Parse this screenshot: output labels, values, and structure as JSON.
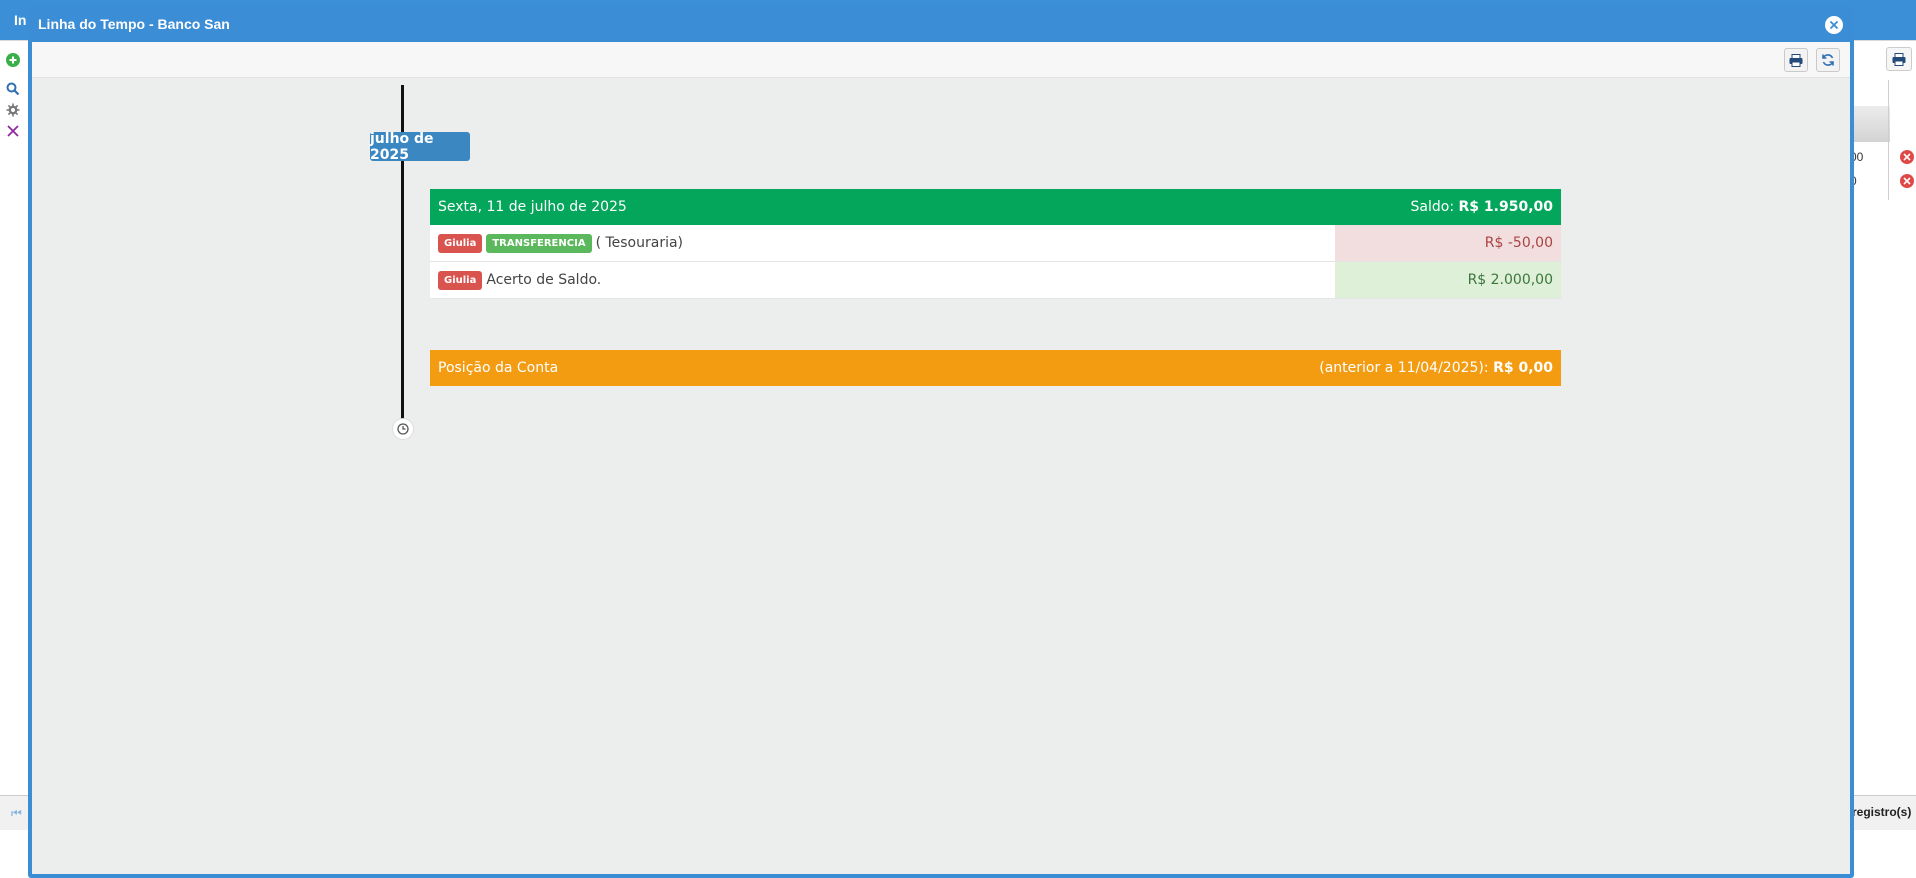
{
  "background": {
    "header_title": "In",
    "rows": [
      {
        "value": "00"
      },
      {
        "value": "0"
      }
    ],
    "records_label": "registro(s)"
  },
  "modal": {
    "title": "Linha do Tempo - Banco San"
  },
  "timeline": {
    "month_label": "julho de 2025",
    "day": {
      "date_label": "Sexta, 11 de julho de 2025",
      "balance_label": "Saldo:",
      "balance_value": "R$ 1.950,00",
      "entries": [
        {
          "user": "Giulia",
          "type": "TRANSFERENCIA",
          "description": "( Tesouraria)",
          "amount": "R$ -50,00",
          "sign": "negative"
        },
        {
          "user": "Giulia",
          "type": "",
          "description": "Acerto de Saldo.",
          "amount": "R$ 2.000,00",
          "sign": "positive"
        }
      ]
    },
    "position": {
      "title": "Posição da Conta",
      "prior_label": "(anterior a 11/04/2025):",
      "prior_value": "R$ 0,00"
    }
  },
  "colors": {
    "window_blue": "#3b8dd6",
    "day_header_green": "#04a65b",
    "position_orange": "#f39c12",
    "month_badge_blue": "#3b87c1",
    "user_badge_red": "#d9534f",
    "type_badge_green": "#5cb85c"
  },
  "icons": [
    "add-icon",
    "search-icon",
    "gear-icon",
    "close-x-icon",
    "print-icon",
    "refresh-icon",
    "close-circle-icon",
    "clock-icon",
    "delete-icon",
    "first-page-icon"
  ]
}
